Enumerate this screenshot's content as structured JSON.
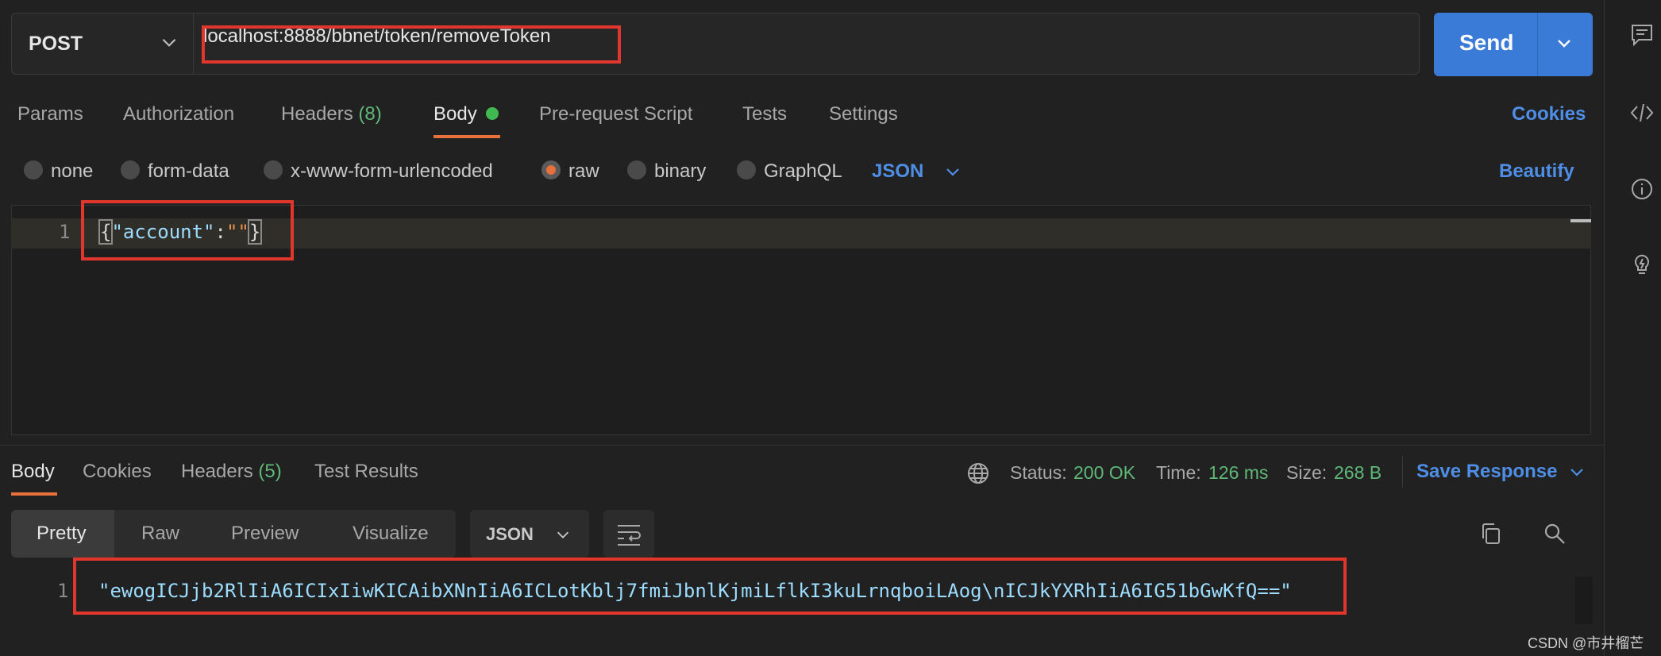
{
  "request": {
    "method": "POST",
    "url": "localhost:8888/bbnet/token/removeToken",
    "send_label": "Send",
    "tabs": [
      {
        "label": "Params"
      },
      {
        "label": "Authorization"
      },
      {
        "label": "Headers",
        "count": "(8)"
      },
      {
        "label": "Body"
      },
      {
        "label": "Pre-request Script"
      },
      {
        "label": "Tests"
      },
      {
        "label": "Settings"
      }
    ],
    "cookies_label": "Cookies",
    "body_modes": [
      "none",
      "form-data",
      "x-www-form-urlencoded",
      "raw",
      "binary",
      "GraphQL"
    ],
    "selected_mode": "raw",
    "format": "JSON",
    "beautify_label": "Beautify",
    "editor": {
      "line_number": "1",
      "brace_open": "{",
      "key": "\"account\"",
      "colon": ":",
      "value": "\"\"",
      "brace_close": "}"
    }
  },
  "response": {
    "tabs": [
      {
        "label": "Body"
      },
      {
        "label": "Cookies"
      },
      {
        "label": "Headers",
        "count": "(5)"
      },
      {
        "label": "Test Results"
      }
    ],
    "status_label": "Status:",
    "status_value": "200 OK",
    "time_label": "Time:",
    "time_value": "126 ms",
    "size_label": "Size:",
    "size_value": "268 B",
    "save_label": "Save Response",
    "view_tabs": [
      "Pretty",
      "Raw",
      "Preview",
      "Visualize"
    ],
    "format": "JSON",
    "line_number": "1",
    "body": "\"ewogICJjb2RlIiA6ICIxIiwKICAibXNnIiA6ICLotKblj7fmiJbnlKjmiLflkI3kuLrnqboiLAog\\nICJkYXRhIiA6IG51bGwKfQ==\""
  },
  "colors": {
    "accent_blue": "#3a7bd8",
    "link_blue": "#4e8ee6",
    "active_orange": "#e8703a",
    "success_green": "#5fb877",
    "annotation_red": "#e0362b"
  },
  "watermark": "CSDN @市井榴芒"
}
